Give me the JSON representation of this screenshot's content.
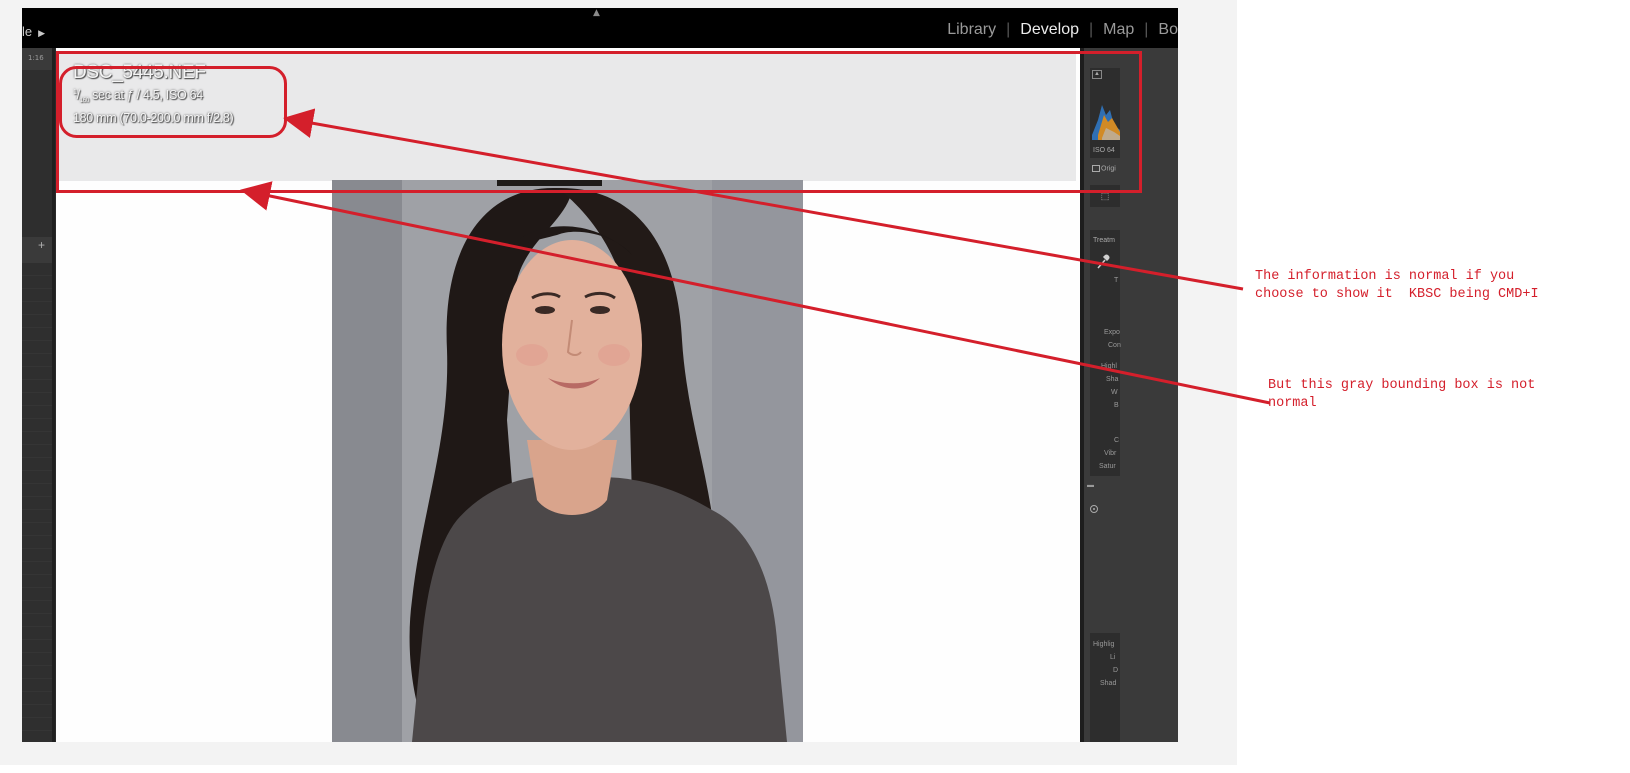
{
  "app": {
    "identity_plate_text": "le",
    "modules": [
      {
        "label": "Library",
        "active": false
      },
      {
        "label": "Develop",
        "active": true
      },
      {
        "label": "Map",
        "active": false
      },
      {
        "label": "Bo",
        "active": false
      }
    ],
    "left_panel": {
      "zoom_ratio": "1:16",
      "add_label": "+"
    },
    "photo_info": {
      "filename": "DSC_5445.NEF",
      "exposure_rest": "sec at ƒ / 4.5, ISO 64",
      "shutter_numerator": "1",
      "shutter_denominator": "160",
      "lens": "180 mm (70.0-200.0 mm f/2.8)"
    },
    "right_panel": {
      "iso_readout": "ISO 64",
      "original_photo_label": "Origi",
      "treatment_label": "Treatm",
      "basic_labels": [
        "T",
        "Expo",
        "Con",
        "Highl",
        "Sha",
        "W",
        "B",
        "C",
        "Vibr",
        "Satur"
      ],
      "tone_labels": [
        "Highlig",
        "Li",
        "D",
        "Shad"
      ]
    }
  },
  "annotations": {
    "note_1": "The information is normal if you\nchoose to show it  KBSC being CMD+I",
    "note_2": "But this gray bounding box is not\nnormal",
    "color": "#d41f2b"
  },
  "colors": {
    "accent_red": "#d41f2b",
    "gray_box": "#e9e9ea",
    "lr_dark": "#2b2b2b"
  }
}
